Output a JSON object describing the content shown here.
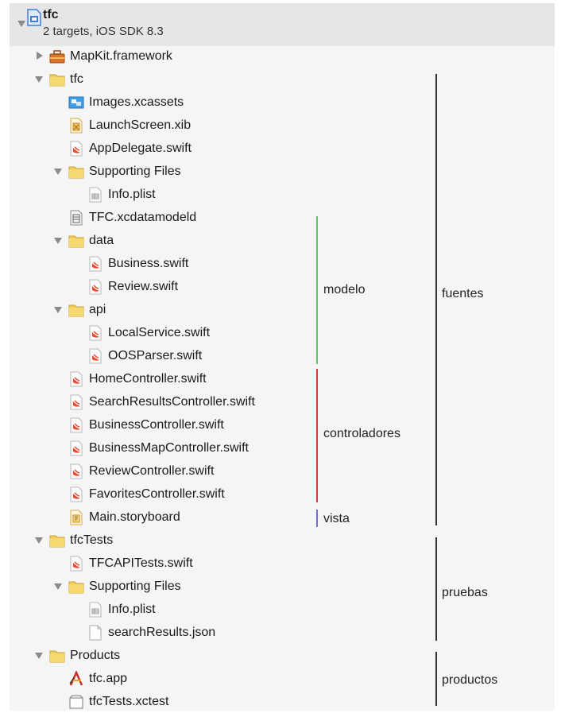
{
  "project": {
    "title": "tfc",
    "subtitle": "2 targets, iOS SDK 8.3"
  },
  "tree": [
    {
      "label": "MapKit.framework",
      "icon": "toolbox-icon",
      "disclosure": "closed"
    },
    {
      "label": "tfc",
      "icon": "folder-icon",
      "disclosure": "open"
    },
    {
      "label": "Images.xcassets",
      "icon": "asset-catalog-icon"
    },
    {
      "label": "LaunchScreen.xib",
      "icon": "xib-icon"
    },
    {
      "label": "AppDelegate.swift",
      "icon": "swift-file-icon"
    },
    {
      "label": "Supporting Files",
      "icon": "folder-icon",
      "disclosure": "open"
    },
    {
      "label": "Info.plist",
      "icon": "plist-icon"
    },
    {
      "label": "TFC.xcdatamodeld",
      "icon": "data-model-icon"
    },
    {
      "label": "data",
      "icon": "folder-icon",
      "disclosure": "open"
    },
    {
      "label": "Business.swift",
      "icon": "swift-file-icon"
    },
    {
      "label": "Review.swift",
      "icon": "swift-file-icon"
    },
    {
      "label": "api",
      "icon": "folder-icon",
      "disclosure": "open"
    },
    {
      "label": "LocalService.swift",
      "icon": "swift-file-icon"
    },
    {
      "label": "OOSParser.swift",
      "icon": "swift-file-icon"
    },
    {
      "label": "HomeController.swift",
      "icon": "swift-file-icon"
    },
    {
      "label": "SearchResultsController.swift",
      "icon": "swift-file-icon"
    },
    {
      "label": "BusinessController.swift",
      "icon": "swift-file-icon"
    },
    {
      "label": "BusinessMapController.swift",
      "icon": "swift-file-icon"
    },
    {
      "label": "ReviewController.swift",
      "icon": "swift-file-icon"
    },
    {
      "label": "FavoritesController.swift",
      "icon": "swift-file-icon"
    },
    {
      "label": "Main.storyboard",
      "icon": "storyboard-icon"
    },
    {
      "label": "tfcTests",
      "icon": "folder-icon",
      "disclosure": "open"
    },
    {
      "label": "TFCAPITests.swift",
      "icon": "swift-file-icon"
    },
    {
      "label": "Supporting Files",
      "icon": "folder-icon",
      "disclosure": "open"
    },
    {
      "label": "Info.plist",
      "icon": "plist-icon"
    },
    {
      "label": "searchResults.json",
      "icon": "blank-file-icon"
    },
    {
      "label": "Products",
      "icon": "folder-icon",
      "disclosure": "open"
    },
    {
      "label": "tfc.app",
      "icon": "app-icon"
    },
    {
      "label": "tfcTests.xctest",
      "icon": "xctest-bundle-icon"
    }
  ],
  "annotations": {
    "modelo": "modelo",
    "controladores": "controladores",
    "vista": "vista",
    "fuentes": "fuentes",
    "pruebas": "pruebas",
    "productos": "productos"
  },
  "colors": {
    "modelo": "#5cc95c",
    "controladores": "#d23a3a",
    "vista": "#6b6bdc",
    "group": "#333333"
  }
}
